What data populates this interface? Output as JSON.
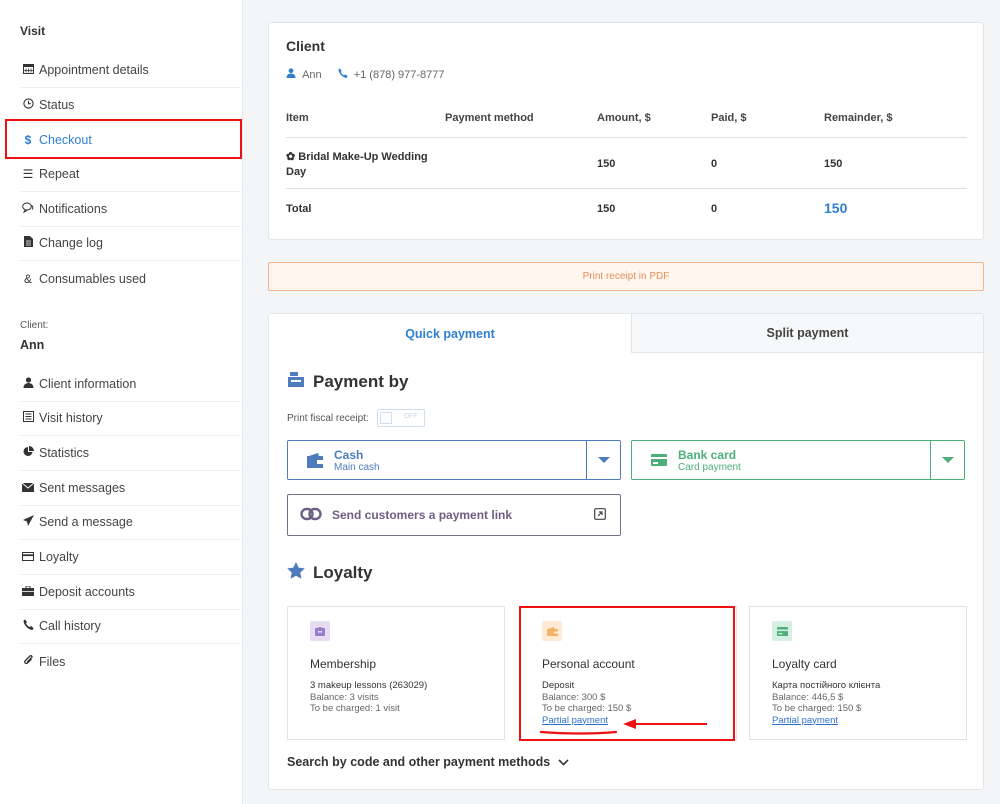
{
  "sidebar": {
    "visit_title": "Visit",
    "visit_items": [
      {
        "label": "Appointment details",
        "icon": "calendar-icon"
      },
      {
        "label": "Status",
        "icon": "clock-icon"
      },
      {
        "label": "Checkout",
        "icon": "dollar-icon",
        "active": true
      },
      {
        "label": "Repeat",
        "icon": "list-icon"
      },
      {
        "label": "Notifications",
        "icon": "chat-icon"
      },
      {
        "label": "Change log",
        "icon": "file-icon"
      },
      {
        "label": "Consumables used",
        "icon": "link-icon"
      }
    ],
    "client_label": "Client:",
    "client_name": "Ann",
    "client_items": [
      {
        "label": "Client information",
        "icon": "user-icon"
      },
      {
        "label": "Visit history",
        "icon": "history-icon"
      },
      {
        "label": "Statistics",
        "icon": "pie-chart-icon"
      },
      {
        "label": "Sent messages",
        "icon": "envelope-icon"
      },
      {
        "label": "Send a message",
        "icon": "send-icon"
      },
      {
        "label": "Loyalty",
        "icon": "card-icon"
      },
      {
        "label": "Deposit accounts",
        "icon": "briefcase-icon"
      },
      {
        "label": "Call history",
        "icon": "phone-icon"
      },
      {
        "label": "Files",
        "icon": "paperclip-icon"
      }
    ]
  },
  "client_card": {
    "title": "Client",
    "name": "Ann",
    "phone": "+1 (878) 977-8777",
    "headers": {
      "item": "Item",
      "method": "Payment method",
      "amount": "Amount, $",
      "paid": "Paid, $",
      "remainder": "Remainder, $"
    },
    "rows": [
      {
        "item": "Bridal Make-Up Wedding Day",
        "method": "",
        "amount": "150",
        "paid": "0",
        "remainder": "150"
      }
    ],
    "total": {
      "label": "Total",
      "amount": "150",
      "paid": "0",
      "remainder": "150"
    }
  },
  "print_receipt_label": "Print receipt in PDF",
  "payment": {
    "tabs": {
      "quick": "Quick payment",
      "split": "Split payment"
    },
    "heading": "Payment by",
    "fiscal_label": "Print fiscal receipt:",
    "fiscal_toggle": "OFF",
    "cash": {
      "title": "Cash",
      "subtitle": "Main cash"
    },
    "bank": {
      "title": "Bank card",
      "subtitle": "Card payment"
    },
    "link_label": "Send customers a payment link",
    "loyalty_heading": "Loyalty",
    "loyalty_cards": {
      "membership": {
        "name": "Membership",
        "line1": "3 makeup lessons (263029)",
        "line2": "Balance: 3 visits",
        "line3": "To be charged: 1 visit"
      },
      "personal": {
        "name": "Personal account",
        "line1": "Deposit",
        "line2": "Balance: 300 $",
        "line3": "To be charged: 150 $",
        "link": "Partial payment"
      },
      "loyalty_card": {
        "name": "Loyalty card",
        "line1": "Карта постійного клієнта",
        "line2": "Balance: 446,5 $",
        "line3": "To be charged: 150 $",
        "link": "Partial payment"
      }
    },
    "search_more": "Search by code and other payment methods"
  },
  "colors": {
    "accent": "#2f7fd1",
    "cash": "#4e7cbd",
    "bank": "#4cae7a",
    "link_purple": "#6d5f82",
    "highlight_red": "#e11111",
    "print_orange": "#e98e57"
  }
}
